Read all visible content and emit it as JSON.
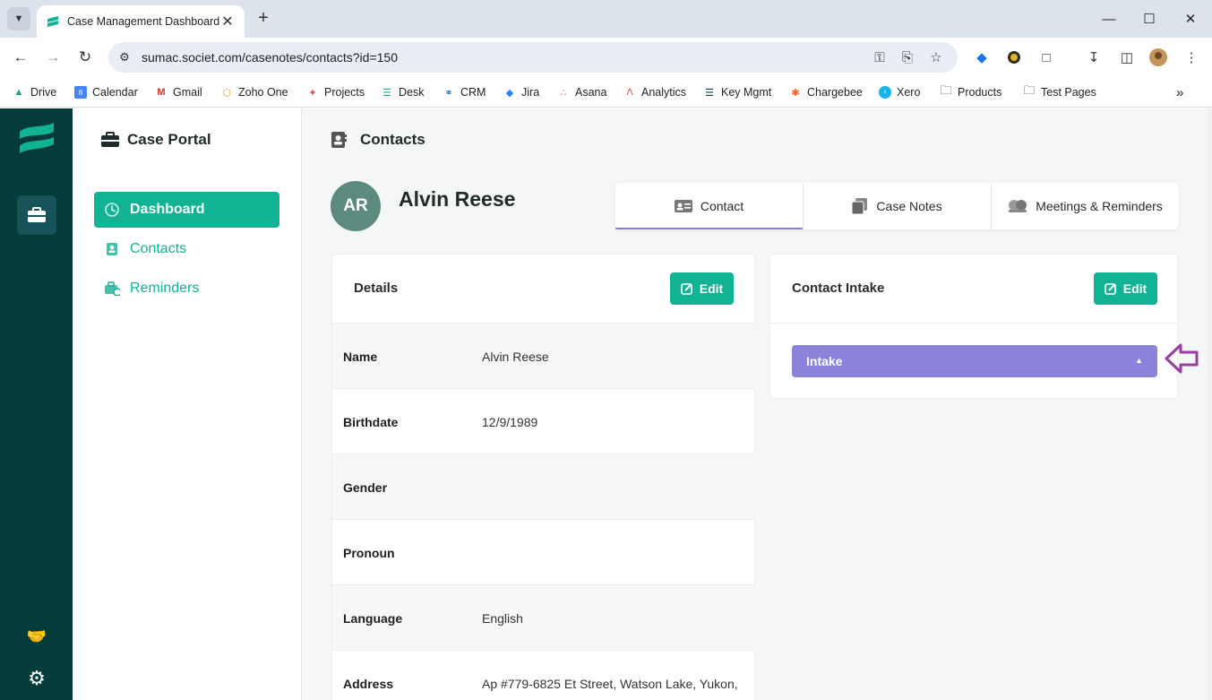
{
  "browser": {
    "tab_title": "Case Management Dashboard",
    "url": "sumac.societ.com/casenotes/contacts?id=150",
    "bookmarks": [
      "Drive",
      "Calendar",
      "Gmail",
      "Zoho One",
      "Projects",
      "Desk",
      "CRM",
      "Jira",
      "Asana",
      "Analytics",
      "Key Mgmt",
      "Chargebee",
      "Xero",
      "Products",
      "Test Pages"
    ]
  },
  "sidebar": {
    "portal_title": "Case Portal",
    "items": [
      {
        "label": "Dashboard",
        "icon": "dashboard-icon",
        "active": true
      },
      {
        "label": "Contacts",
        "icon": "contacts-icon",
        "active": false
      },
      {
        "label": "Reminders",
        "icon": "reminders-icon",
        "active": false
      }
    ]
  },
  "main": {
    "page_title": "Contacts",
    "contact": {
      "initials": "AR",
      "name": "Alvin Reese"
    },
    "tabs": [
      {
        "label": "Contact",
        "icon": "contact-card-icon",
        "active": true
      },
      {
        "label": "Case Notes",
        "icon": "notes-icon",
        "active": false
      },
      {
        "label": "Meetings & Reminders",
        "icon": "meetings-icon",
        "active": false
      }
    ],
    "details": {
      "title": "Details",
      "edit_label": "Edit",
      "rows": [
        {
          "label": "Name",
          "value": "Alvin Reese"
        },
        {
          "label": "Birthdate",
          "value": "12/9/1989"
        },
        {
          "label": "Gender",
          "value": ""
        },
        {
          "label": "Pronoun",
          "value": ""
        },
        {
          "label": "Language",
          "value": "English"
        },
        {
          "label": "Address",
          "value": "Ap #779-6825 Et Street, Watson Lake, Yukon,"
        }
      ]
    },
    "intake": {
      "title": "Contact Intake",
      "edit_label": "Edit",
      "section_label": "Intake"
    }
  },
  "colors": {
    "accent": "#12b394",
    "rail": "#043c3c",
    "intake": "#8b83d9",
    "annotation_arrow": "#9b3d9f"
  }
}
